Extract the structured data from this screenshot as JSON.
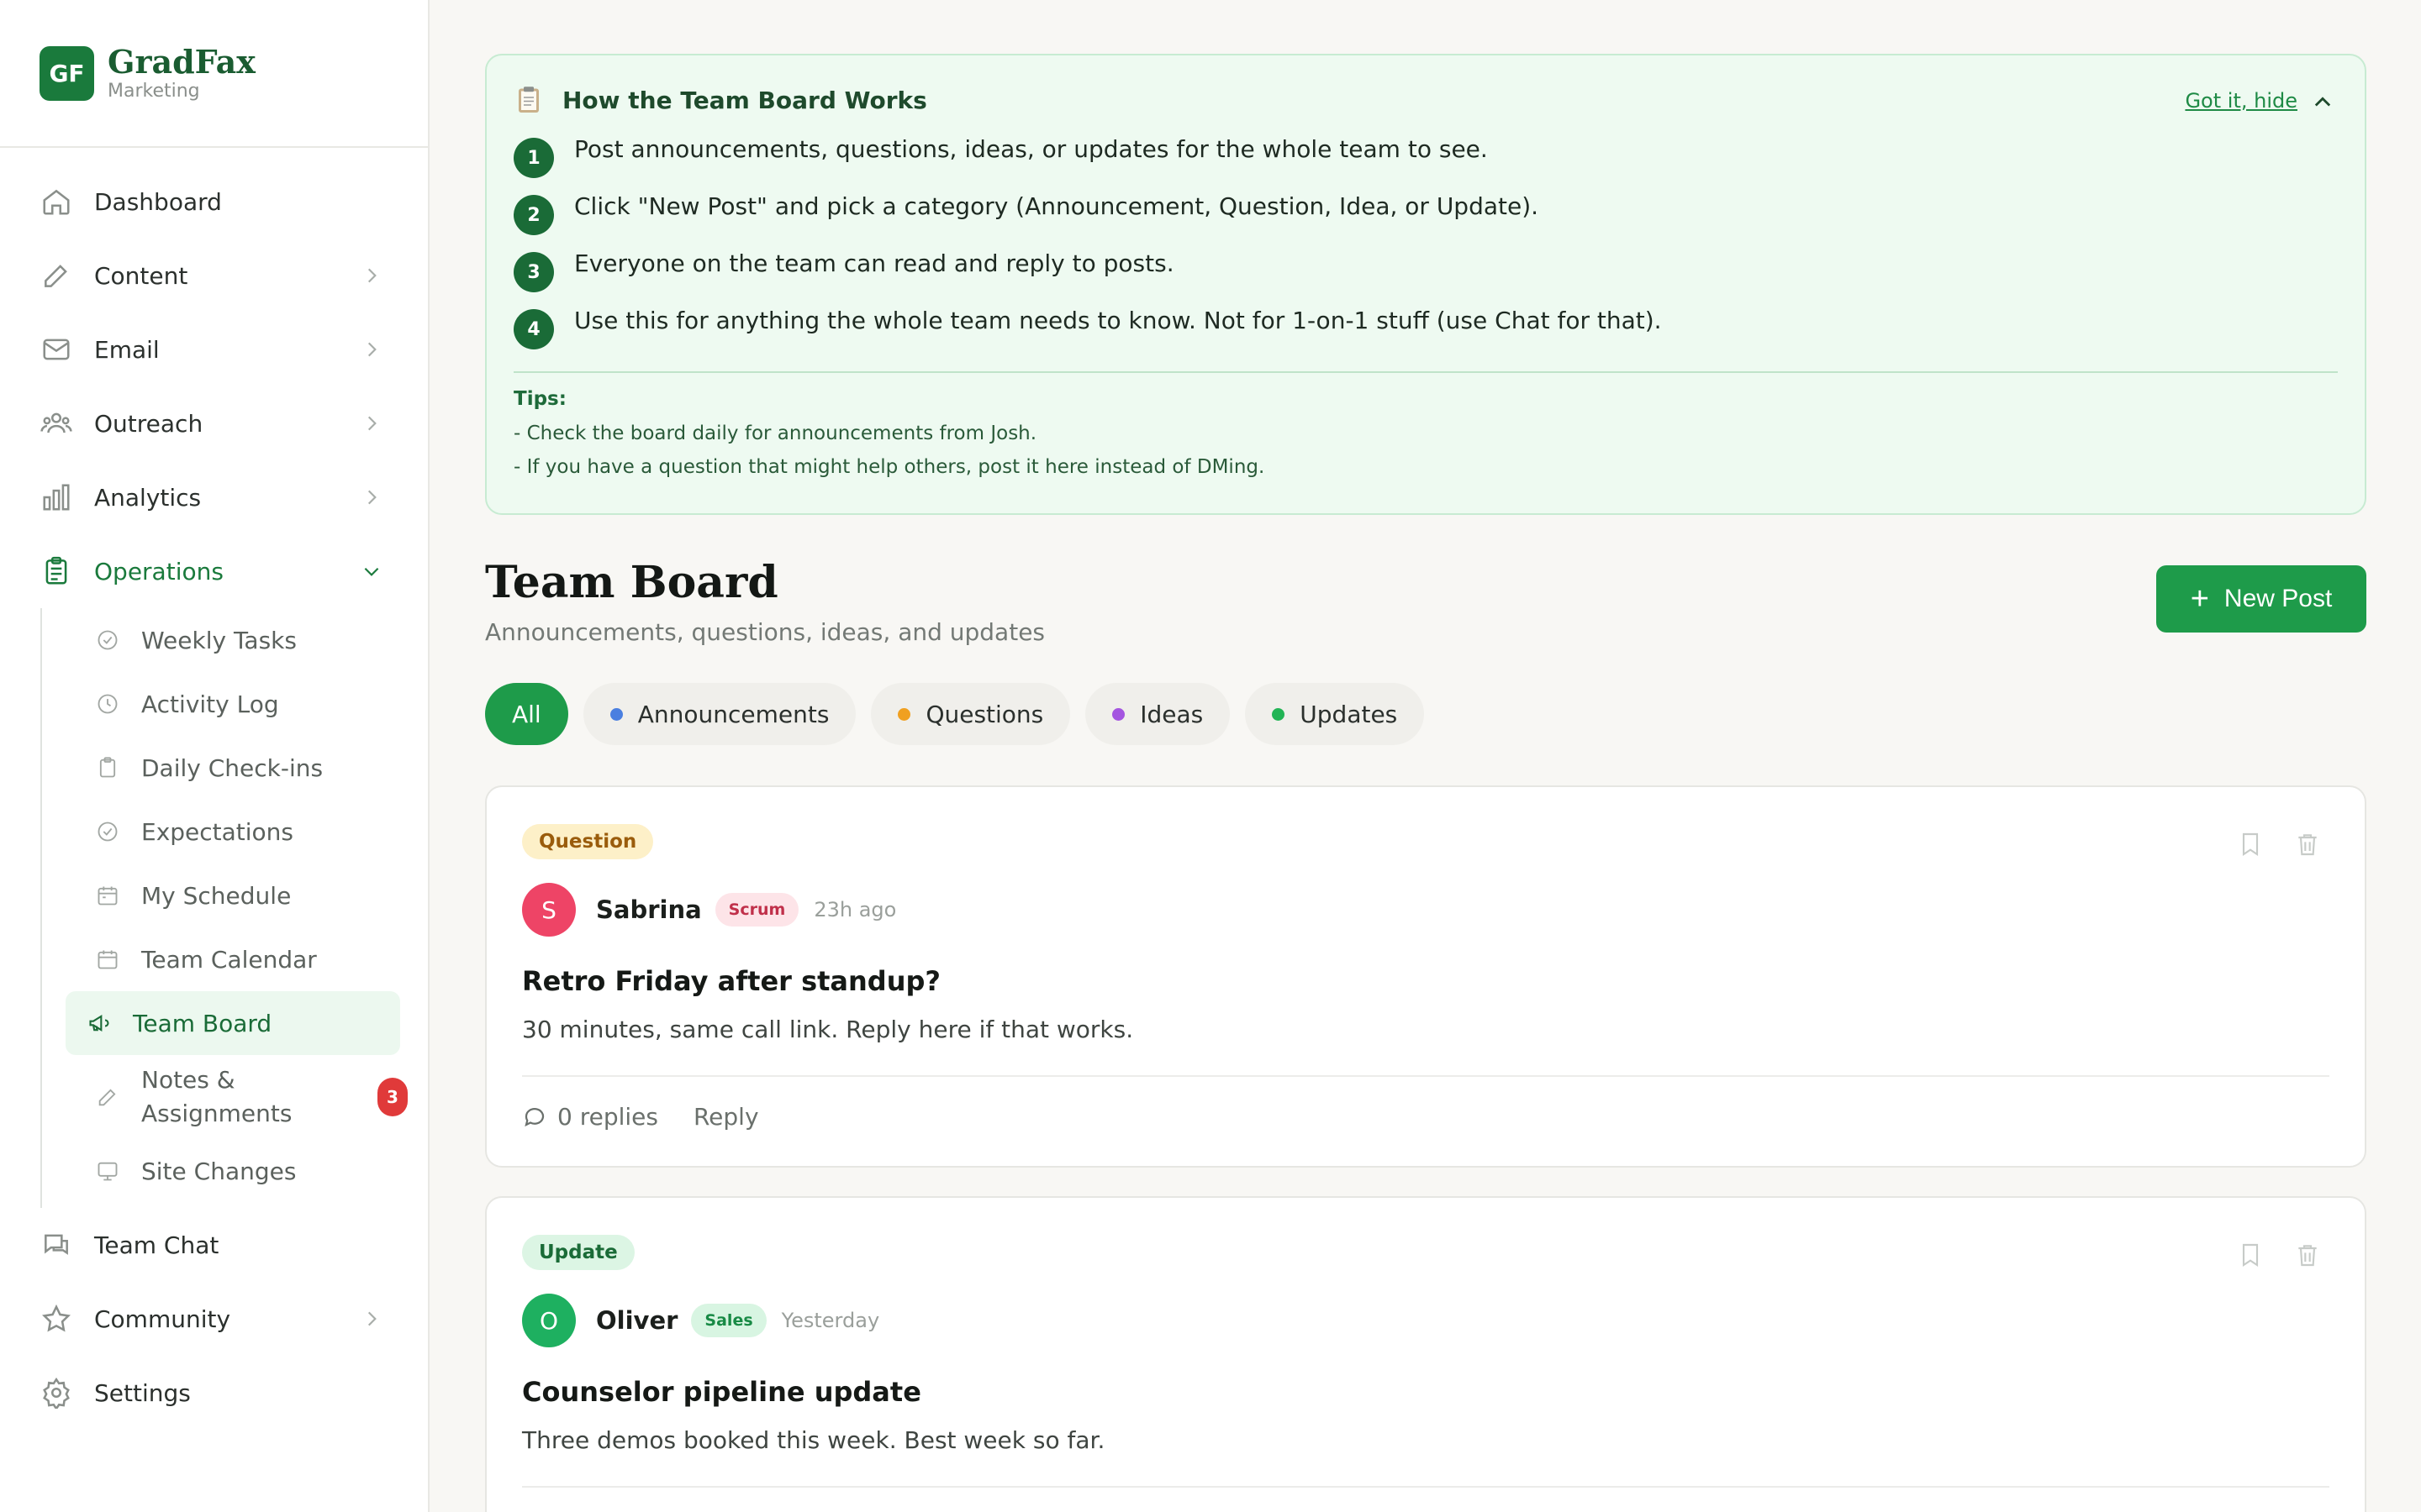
{
  "brand": {
    "logo": "GF",
    "name": "GradFax",
    "subtitle": "Marketing"
  },
  "nav": {
    "dashboard": "Dashboard",
    "content": "Content",
    "email": "Email",
    "outreach": "Outreach",
    "analytics": "Analytics",
    "operations": "Operations",
    "team_chat": "Team Chat",
    "community": "Community",
    "settings": "Settings"
  },
  "subnav": {
    "weekly_tasks": "Weekly Tasks",
    "activity_log": "Activity Log",
    "daily_checkins": "Daily Check-ins",
    "expectations": "Expectations",
    "my_schedule": "My Schedule",
    "team_calendar": "Team Calendar",
    "team_board": "Team Board",
    "notes_line1": "Notes &",
    "notes_line2": "Assignments",
    "notes_badge": "3",
    "site_changes": "Site Changes"
  },
  "howto": {
    "title": "How the Team Board Works",
    "hide_link": "Got it, hide",
    "steps": [
      "Post announcements, questions, ideas, or updates for the whole team to see.",
      "Click \"New Post\" and pick a category (Announcement, Question, Idea, or Update).",
      "Everyone on the team can read and reply to posts.",
      "Use this for anything the whole team needs to know. Not for 1-on-1 stuff (use Chat for that)."
    ],
    "step_numbers": [
      "1",
      "2",
      "3",
      "4"
    ],
    "tips_title": "Tips:",
    "tips": [
      "-  Check the board daily for announcements from Josh.",
      "-  If you have a question that might help others, post it here instead of DMing."
    ]
  },
  "board": {
    "title": "Team Board",
    "subtitle": "Announcements, questions, ideas, and updates",
    "new_post": "New Post"
  },
  "filters": {
    "all": "All",
    "announcements": "Announcements",
    "questions": "Questions",
    "ideas": "Ideas",
    "updates": "Updates"
  },
  "colors": {
    "accent": "#1e9b4a",
    "announcements_dot": "#4a7fe0",
    "questions_dot": "#f0a020",
    "ideas_dot": "#a455e0",
    "updates_dot": "#22b455"
  },
  "posts": [
    {
      "category": "Question",
      "avatar": "S",
      "author": "Sabrina",
      "team": "Scrum",
      "time": "23h ago",
      "title": "Retro Friday after standup?",
      "body": "30 minutes, same call link. Reply here if that works.",
      "replies": "0 replies",
      "reply_label": "Reply"
    },
    {
      "category": "Update",
      "avatar": "O",
      "author": "Oliver",
      "team": "Sales",
      "time": "Yesterday",
      "title": "Counselor pipeline update",
      "body": "Three demos booked this week. Best week so far.",
      "replies": "",
      "reply_label": ""
    }
  ]
}
